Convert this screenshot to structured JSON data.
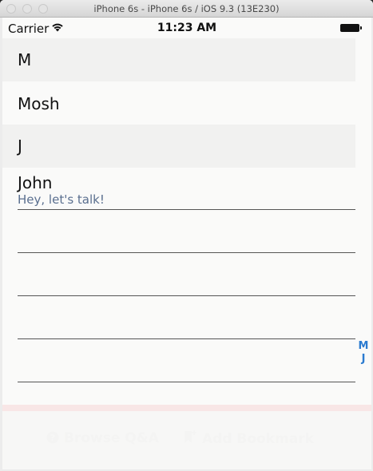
{
  "window": {
    "title": "iPhone 6s - iPhone 6s / iOS 9.3 (13E230)"
  },
  "statusbar": {
    "carrier": "Carrier",
    "time": "11:23 AM"
  },
  "sections": [
    {
      "header": "M",
      "items": [
        {
          "title": "Mosh",
          "subtitle": ""
        }
      ]
    },
    {
      "header": "J",
      "items": [
        {
          "title": "John",
          "subtitle": "Hey, let's talk!"
        }
      ]
    }
  ],
  "index": [
    "M",
    "J"
  ],
  "tabbar": {
    "browse_label": "Browse Q&A",
    "bookmark_label": "Add Bookmark"
  },
  "colors": {
    "index_accent": "#2b7bd0",
    "subtitle": "#5a6f8f",
    "section_header_bg": "#f1f1f0"
  }
}
